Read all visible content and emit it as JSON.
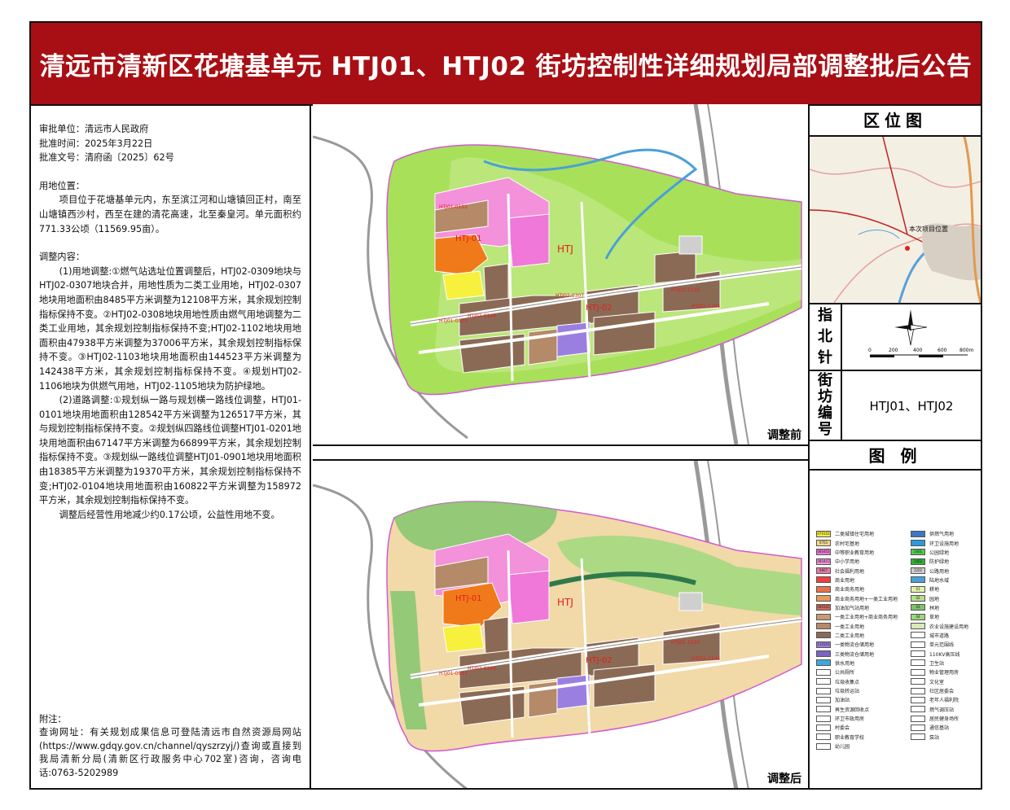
{
  "title": "清远市清新区花塘基单元 HTJ01、HTJ02 街坊控制性详细规划局部调整批后公告",
  "info": {
    "unit": "审批单位：清远市人民政府",
    "date": "批准时间：2025年3月22日",
    "doc": "批准文号：清府函〔2025〕62号"
  },
  "location": {
    "heading": "用地位置：",
    "text": "项目位于花塘基单元内，东至滨江河和山塘镇回正村，南至山塘镇西沙村，西至在建的清花高速，北至秦皇河。单元面积约771.33公顷（11569.95亩）。"
  },
  "adjust": {
    "heading": "调整内容：",
    "p1": "(1)用地调整:①燃气站选址位置调整后，HTJ02-0309地块与HTJ02-0307地块合并，用地性质为二类工业用地，HTJ02-0307地块用地面积由8485平方米调整为12108平方米，其余规划控制指标保持不变。②HTJ02-0308地块用地性质由燃气用地调整为二类工业用地，其余规划控制指标保持不变;HTJ02-1102地块用地面积由47938平方米调整为37006平方米，其余规划控制指标保持不变。③HTJ02-1103地块用地面积由144523平方米调整为142438平方米，其余规划控制指标保持不变。④规划HTJ02-1106地块为供燃气用地，HTJ02-1105地块为防护绿地。",
    "p2": "(2)道路调整:①规划纵一路与规划横一路线位调整，HTJ01-0101地块用地面积由128542平方米调整为126517平方米，其与规划控制指标保持不变。②规划纵四路线位调整HTJ01-0201地块用地面积由67147平方米调整为66899平方米，其余规划控制指标保持不变。③规划纵一路线位调整HTJ01-0901地块用地面积由18385平方米调整为19370平方米，其余规划控制指标保持不变;HTJ02-0104地块用地面积由160822平方米调整为158972平方米，其余规划控制指标保持不变。",
    "p3": "调整后经营性用地减少约0.17公顷，公益性用地不变。"
  },
  "note": {
    "heading": "附注：",
    "text": "查询网址：有关规划成果信息可登陆清远市自然资源局网站(https://www.gdqy.gov.cn/channel/qyszrzyj/)查询或直接到我局清新分局(清新区行政服务中心702室)咨询，咨询电话:0763-5202989"
  },
  "maps": {
    "before_caption": "调整前",
    "after_caption": "调整后",
    "district_label": "HTJ",
    "sub1": "HTJ-01",
    "sub2": "HTJ-02",
    "parcels": [
      "HTJ01-0101",
      "HTJ02-0307",
      "HTJ02-1103",
      "HTJ02-1104",
      "HTJ01-0901",
      "HTJ02-0104",
      "070102",
      "090102",
      "090403",
      "110102",
      "100101",
      "101101",
      "090402",
      "120101",
      "1202",
      "080402"
    ]
  },
  "right_panel": {
    "location_title": "区位图",
    "location_label": "本次项目位置",
    "north_label": [
      "指",
      "北",
      "针"
    ],
    "scale_ticks": [
      "0",
      "200",
      "400",
      "600",
      "800m"
    ],
    "block_label": [
      "街",
      "坊",
      "编",
      "号"
    ],
    "block_value": "HTJ01、HTJ02",
    "legend_title": "图 例"
  },
  "legend_left": [
    {
      "code": "070102",
      "label": "二类城镇住宅用地",
      "color": "#f7f03c"
    },
    {
      "code": "0703",
      "label": "农村宅基地",
      "color": "#f3d78a"
    },
    {
      "code": "080402",
      "label": "中等职业教育用地",
      "color": "#f078d8"
    },
    {
      "code": "080403",
      "label": "中小学用地",
      "color": "#f391db"
    },
    {
      "code": "0807",
      "label": "社会福利用地",
      "color": "#e87ba6"
    },
    {
      "code": "",
      "label": "商业用地",
      "color": "#ef4040"
    },
    {
      "code": "",
      "label": "商业商务用地",
      "color": "#e8734a"
    },
    {
      "code": "",
      "label": "商业商务用地+一类工业用地",
      "color": "#e59a5b"
    },
    {
      "code": "090105",
      "label": "加油加气站用地",
      "color": "#d36a5a"
    },
    {
      "code": "",
      "label": "一类工业用地+商业商务用地",
      "color": "#c79b72"
    },
    {
      "code": "",
      "label": "一类工业用地",
      "color": "#b58a68"
    },
    {
      "code": "",
      "label": "二类工业用地",
      "color": "#8b6a55"
    },
    {
      "code": "110101",
      "label": "一类物流仓储用地",
      "color": "#9b7fe0"
    },
    {
      "code": "",
      "label": "三类物流仓储用地",
      "color": "#7a63c2"
    },
    {
      "code": "",
      "label": "供水用地",
      "color": "#3fa7e0"
    },
    {
      "code": "",
      "label": "公共厕所",
      "color": "#ffffff"
    },
    {
      "code": "",
      "label": "垃圾收集点",
      "color": "#ffffff"
    },
    {
      "code": "",
      "label": "垃圾转运站",
      "color": "#ffffff"
    },
    {
      "code": "",
      "label": "加油站",
      "color": "#ffffff"
    },
    {
      "code": "",
      "label": "再生资源回收点",
      "color": "#ffffff"
    },
    {
      "code": "",
      "label": "环卫市政用房",
      "color": "#ffffff"
    },
    {
      "code": "",
      "label": "村委会",
      "color": "#ffffff"
    },
    {
      "code": "",
      "label": "职业教育学校",
      "color": "#ffffff"
    },
    {
      "code": "",
      "label": "幼儿园",
      "color": "#ffffff"
    }
  ],
  "legend_right": [
    {
      "code": "",
      "label": "供燃气用地",
      "color": "#3a78c8"
    },
    {
      "code": "",
      "label": "环卫设施用地",
      "color": "#2c9ad8"
    },
    {
      "code": "1401",
      "label": "公园绿地",
      "color": "#4ec84e"
    },
    {
      "code": "1402",
      "label": "防护绿地",
      "color": "#2fb02f"
    },
    {
      "code": "1202",
      "label": "公路用地",
      "color": "#cfcfcf"
    },
    {
      "code": "",
      "label": "陆地水域",
      "color": "#4aa0d8"
    },
    {
      "code": "01",
      "label": "耕地",
      "color": "#e3f3a8"
    },
    {
      "code": "02",
      "label": "园地",
      "color": "#b5e08a"
    },
    {
      "code": "03",
      "label": "林地",
      "color": "#7cc46a"
    },
    {
      "code": "04",
      "label": "草地",
      "color": "#9bd87a"
    },
    {
      "code": "",
      "label": "农业设施建设用地",
      "color": "#d8e8b8"
    },
    {
      "code": "",
      "label": "城市道路",
      "color": "#ffffff"
    },
    {
      "code": "",
      "label": "单元范围线",
      "color": "#ffffff"
    },
    {
      "code": "",
      "label": "110KV高压线",
      "color": "#ffffff"
    },
    {
      "code": "",
      "label": "卫生站",
      "color": "#ffffff"
    },
    {
      "code": "",
      "label": "物业管理用房",
      "color": "#ffffff"
    },
    {
      "code": "",
      "label": "文化室",
      "color": "#ffffff"
    },
    {
      "code": "",
      "label": "社区居委会",
      "color": "#ffffff"
    },
    {
      "code": "",
      "label": "老年人福利院",
      "color": "#ffffff"
    },
    {
      "code": "",
      "label": "燃气调压站",
      "color": "#ffffff"
    },
    {
      "code": "",
      "label": "居民健身场所",
      "color": "#ffffff"
    },
    {
      "code": "",
      "label": "通信基站",
      "color": "#ffffff"
    },
    {
      "code": "",
      "label": "泵站",
      "color": "#ffffff"
    }
  ]
}
